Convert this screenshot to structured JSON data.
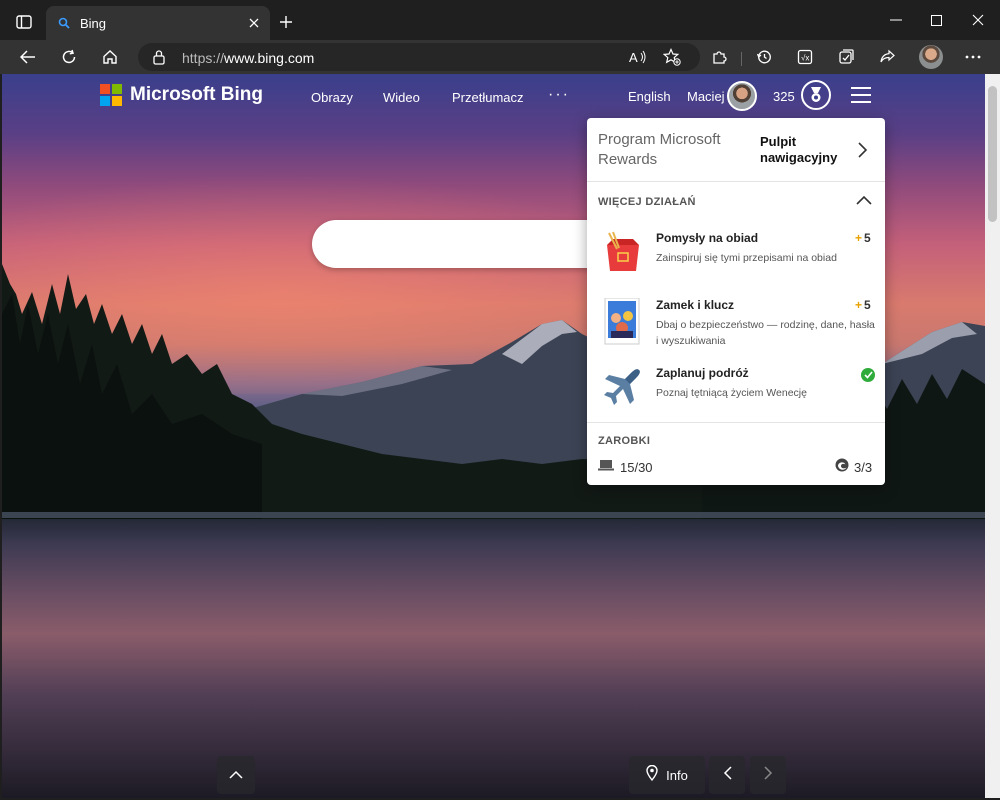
{
  "browser": {
    "tab": {
      "title": "Bing"
    },
    "address": {
      "url_prefix": "https://",
      "url_host": "www.bing.com"
    },
    "icons": {
      "tab_actions": "tab-actions-icon",
      "favicon": "bing-search-icon",
      "close": "close-icon",
      "new_tab": "plus-icon",
      "back": "back-arrow-icon",
      "refresh": "refresh-icon",
      "home": "home-icon",
      "lock": "lock-icon",
      "read_aloud": "read-aloud-icon",
      "favorites": "add-favorite-icon",
      "extensions": "extensions-icon",
      "history": "history-icon",
      "screenshot": "web-capture-icon",
      "collections": "collections-icon",
      "share": "share-icon",
      "more": "more-icon"
    }
  },
  "header": {
    "logo_text": "Microsoft Bing",
    "nav": [
      "Obrazy",
      "Wideo",
      "Przetłumacz"
    ],
    "more_dots": "···",
    "language": "English",
    "user_name": "Maciej",
    "points": "325"
  },
  "rewards_panel": {
    "program_title": "Program Microsoft Rewards",
    "dashboard_label": "Pulpit nawigacyjny",
    "more_actions_label": "WIĘCEJ DZIAŁAŃ",
    "activities": [
      {
        "title": "Pomysły na obiad",
        "description": "Zainspiruj się tymi przepisami na obiad",
        "points": "5",
        "completed": false
      },
      {
        "title": "Zamek i klucz",
        "description": "Dbaj o bezpieczeństwo — rodzinę, dane, hasła i wyszukiwania",
        "points": "5",
        "completed": false
      },
      {
        "title": "Zaplanuj podróż",
        "description": "Poznaj tętniącą życiem Wenecję",
        "points": "",
        "completed": true
      }
    ],
    "earnings_label": "ZAROBKI",
    "pc_search": "15/30",
    "edge_bonus": "3/3"
  },
  "bottom": {
    "info_label": "Info"
  },
  "colors": {
    "ms_red": "#f25022",
    "ms_green": "#7fba00",
    "ms_blue": "#00a4ef",
    "ms_yellow": "#ffb900",
    "points_plus": "#e8a200",
    "check_green": "#2eab3a"
  }
}
